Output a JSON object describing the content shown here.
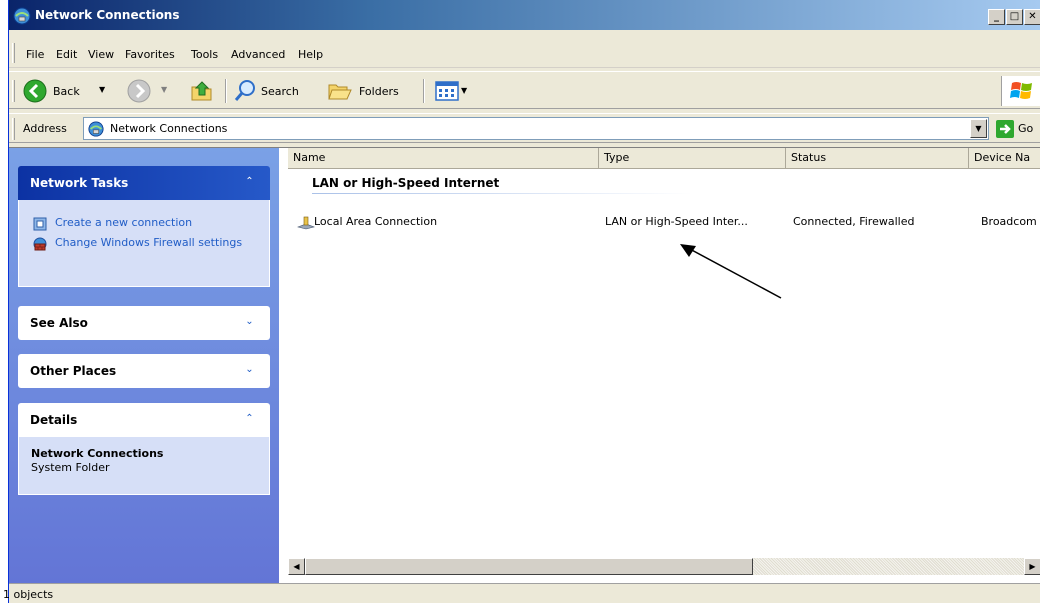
{
  "window": {
    "title": "Network Connections"
  },
  "menubar": {
    "items": [
      "File",
      "Edit",
      "View",
      "Favorites",
      "Tools",
      "Advanced",
      "Help"
    ]
  },
  "toolbar": {
    "back_label": "Back",
    "search_label": "Search",
    "folders_label": "Folders"
  },
  "address": {
    "label": "Address",
    "value": "Network Connections",
    "go_label": "Go"
  },
  "taskpane": {
    "network_tasks": {
      "title": "Network Tasks",
      "items": [
        "Create a new connection",
        "Change Windows Firewall settings"
      ]
    },
    "see_also": {
      "title": "See Also"
    },
    "other_places": {
      "title": "Other Places"
    },
    "details": {
      "title": "Details",
      "name": "Network Connections",
      "kind": "System Folder"
    }
  },
  "list": {
    "columns": [
      "Name",
      "Type",
      "Status",
      "Device Na"
    ],
    "group": "LAN or High-Speed Internet",
    "items": [
      {
        "name": "Local Area Connection",
        "type": "LAN or High-Speed Inter...",
        "status": "Connected, Firewalled",
        "device": "Broadcom"
      }
    ]
  },
  "statusbar": {
    "text": "1 objects"
  },
  "icons": [
    "network-connections-icon",
    "windows-logo-icon",
    "back-icon",
    "forward-icon",
    "up-folder-icon",
    "search-icon",
    "folders-icon",
    "views-icon",
    "go-icon",
    "new-connection-icon",
    "firewall-icon",
    "lan-connection-icon",
    "annotation-arrow"
  ]
}
